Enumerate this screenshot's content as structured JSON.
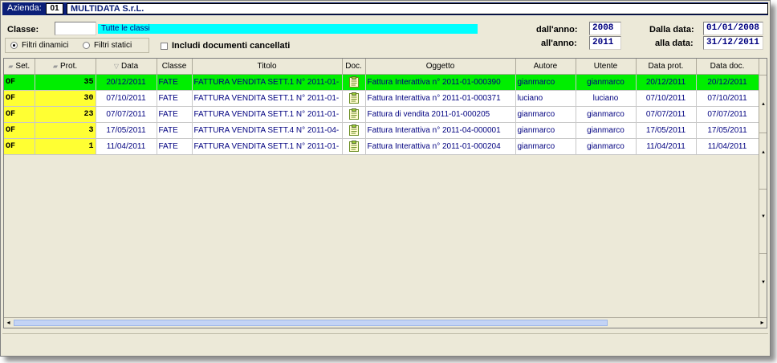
{
  "header": {
    "azienda_label": "Azienda:",
    "azienda_code": "01",
    "azienda_name": "MULTIDATA S.r.L."
  },
  "filters": {
    "classe_label": "Classe:",
    "classe_value": "",
    "classe_description": "Tutte le classi",
    "radio_dynamic": "Filtri dinamici",
    "radio_static": "Filtri statici",
    "include_deleted": "Includi documenti cancellati",
    "dall_anno_label": "dall'anno:",
    "dall_anno_value": "2008",
    "all_anno_label": "all'anno:",
    "all_anno_value": "2011",
    "dalla_data_label": "Dalla data:",
    "dalla_data_value": "01/01/2008",
    "alla_data_label": "alla data:",
    "alla_data_value": "31/12/2011"
  },
  "table": {
    "columns": [
      "Set.",
      "Prot.",
      "Data",
      "Classe",
      "Titolo",
      "Doc.",
      "Oggetto",
      "Autore",
      "Utente",
      "Data prot.",
      "Data doc."
    ],
    "rows": [
      {
        "set": "OF",
        "prot": "35",
        "data": "20/12/2011",
        "classe": "FATE",
        "titolo": "FATTURA VENDITA SETT.1 N° 2011-01-",
        "oggetto": "Fattura Interattiva n° 2011-01-000390",
        "autore": "gianmarco",
        "utente": "gianmarco",
        "data_prot": "20/12/2011",
        "data_doc": "20/12/2011"
      },
      {
        "set": "OF",
        "prot": "30",
        "data": "07/10/2011",
        "classe": "FATE",
        "titolo": "FATTURA VENDITA SETT.1 N° 2011-01-",
        "oggetto": "Fattura Interattiva n° 2011-01-000371",
        "autore": "luciano",
        "utente": "luciano",
        "data_prot": "07/10/2011",
        "data_doc": "07/10/2011"
      },
      {
        "set": "OF",
        "prot": "23",
        "data": "07/07/2011",
        "classe": "FATE",
        "titolo": "FATTURA VENDITA SETT.1 N° 2011-01-",
        "oggetto": "Fattura di vendita 2011-01-000205",
        "autore": "gianmarco",
        "utente": "gianmarco",
        "data_prot": "07/07/2011",
        "data_doc": "07/07/2011"
      },
      {
        "set": "OF",
        "prot": "3",
        "data": "17/05/2011",
        "classe": "FATE",
        "titolo": "FATTURA VENDITA SETT.4 N° 2011-04-",
        "oggetto": "Fattura Interattiva n° 2011-04-000001",
        "autore": "gianmarco",
        "utente": "gianmarco",
        "data_prot": "17/05/2011",
        "data_doc": "17/05/2011"
      },
      {
        "set": "OF",
        "prot": "1",
        "data": "11/04/2011",
        "classe": "FATE",
        "titolo": "FATTURA VENDITA SETT.1 N° 2011-01-",
        "oggetto": "Fattura Interattiva n° 2011-01-000204",
        "autore": "gianmarco",
        "utente": "gianmarco",
        "data_prot": "11/04/2011",
        "data_doc": "11/04/2011"
      }
    ]
  },
  "icons": {
    "doc": "document-clipboard-icon"
  },
  "colors": {
    "title_bg": "#0b1f78",
    "selected_row": "#00ee00",
    "set_prot_bg": "#ffff33",
    "classe_bar": "#00ffff"
  }
}
